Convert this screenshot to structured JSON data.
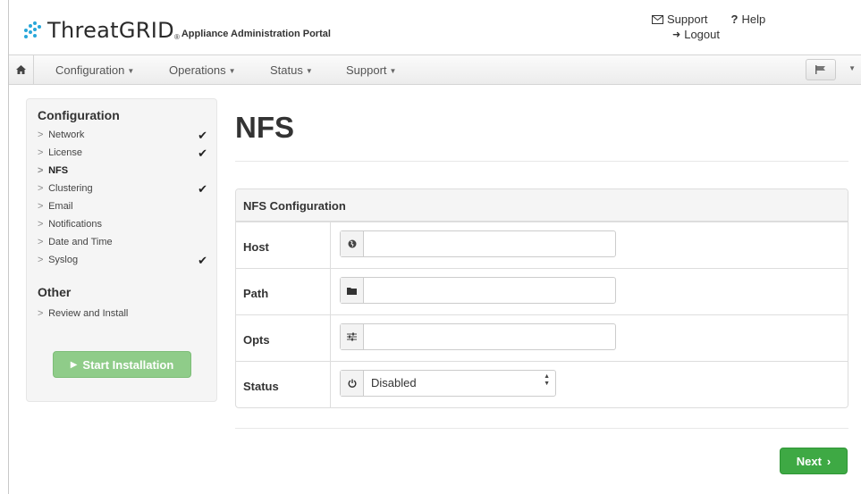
{
  "header": {
    "brand_name": "ThreatGRID",
    "brand_trademark": "®",
    "brand_subtitle": "Appliance Administration Portal",
    "links": {
      "support": "Support",
      "help": "Help",
      "logout": "Logout"
    }
  },
  "nav": {
    "items": [
      {
        "label": "Configuration"
      },
      {
        "label": "Operations"
      },
      {
        "label": "Status"
      },
      {
        "label": "Support"
      }
    ]
  },
  "sidebar": {
    "configuration_heading": "Configuration",
    "items": [
      {
        "label": "Network",
        "checked": true
      },
      {
        "label": "License",
        "checked": true
      },
      {
        "label": "NFS",
        "checked": false,
        "active": true
      },
      {
        "label": "Clustering",
        "checked": true
      },
      {
        "label": "Email",
        "checked": false
      },
      {
        "label": "Notifications",
        "checked": false
      },
      {
        "label": "Date and Time",
        "checked": false
      },
      {
        "label": "Syslog",
        "checked": true
      }
    ],
    "other_heading": "Other",
    "other_items": [
      {
        "label": "Review and Install"
      }
    ],
    "start_button": "Start Installation"
  },
  "main": {
    "title": "NFS",
    "panel_title": "NFS Configuration",
    "fields": {
      "host": {
        "label": "Host",
        "value": "",
        "icon": "globe-icon"
      },
      "path": {
        "label": "Path",
        "value": "",
        "icon": "folder-icon"
      },
      "opts": {
        "label": "Opts",
        "value": "",
        "icon": "sliders-icon"
      },
      "status": {
        "label": "Status",
        "value": "Disabled",
        "icon": "power-icon"
      }
    },
    "next_button": "Next"
  },
  "colors": {
    "accent_green": "#3ea944",
    "start_button_green": "#8fcc89",
    "brand_blue": "#29a7d9"
  }
}
